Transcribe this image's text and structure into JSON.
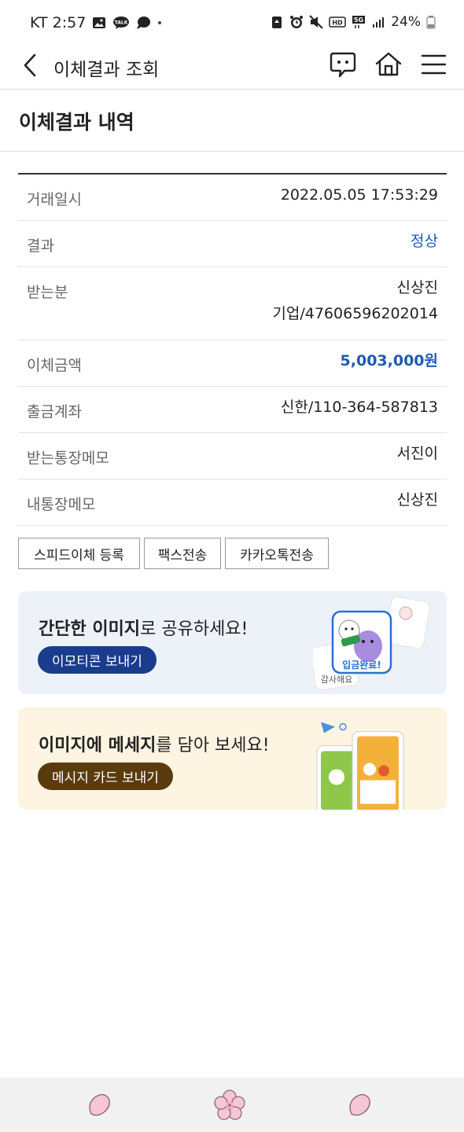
{
  "status_bar": {
    "carrier_time": "KT 2:57",
    "left_icons": [
      "gallery-icon",
      "kakaotalk-icon",
      "chat-icon",
      "dot-icon"
    ],
    "right_icons": [
      "recycle-icon",
      "alarm-icon",
      "mute-icon",
      "hd-icon",
      "5g-icon",
      "signal-icon"
    ],
    "battery": "24%",
    "hd_label": "HD",
    "network_label": "5G",
    "talk_badge": "TALK"
  },
  "header": {
    "title": "이체결과 조회",
    "icons": [
      "back-icon",
      "chat-bubble-icon",
      "home-icon",
      "menu-icon"
    ]
  },
  "section": {
    "title": "이체결과 내역"
  },
  "details": {
    "rows": [
      {
        "label": "거래일시",
        "value": "2022.05.05 17:53:29"
      },
      {
        "label": "결과",
        "value": "정상"
      },
      {
        "label": "받는분",
        "value": "신상진",
        "value2": "기업/47606596202014"
      },
      {
        "label": "이체금액",
        "value": "5,003,000원"
      },
      {
        "label": "출금계좌",
        "value": "신한/110-364-587813"
      },
      {
        "label": "받는통장메모",
        "value": "서진이"
      },
      {
        "label": "내통장메모",
        "value": "신상진"
      }
    ]
  },
  "actions": {
    "speed_transfer": "스피드이체 등록",
    "fax": "팩스전송",
    "kakao": "카카오톡전송"
  },
  "banner1": {
    "text_bold": "간단한 이미지",
    "text_rest": "로 공유하세요!",
    "button": "이모티콘 보내기",
    "art_label": "입금완료!",
    "art_sub": "감사해요"
  },
  "banner2": {
    "text_bold": "이미지에 메세지",
    "text_rest": "를 담아 보세요!",
    "button": "메시지 카드 보내기"
  },
  "colors": {
    "accent_blue": "#1f5bb2",
    "banner1_bg": "#edf2f9",
    "banner2_bg": "#fdf4e1",
    "banner1_button": "#1a3c8c",
    "banner2_button": "#5a3b0c",
    "bottom_nav_bg": "#f1f1f1",
    "petal_pink": "#f6c6d6"
  },
  "bottom_nav": {
    "icons": [
      "petal-left-icon",
      "cherry-blossom-icon",
      "petal-right-icon"
    ]
  }
}
